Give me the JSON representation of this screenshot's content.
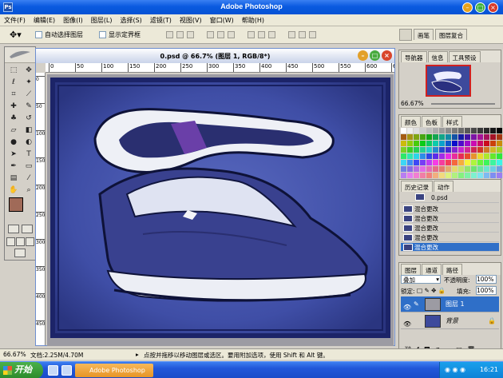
{
  "app": {
    "title": "Adobe Photoshop",
    "icon": "Ps"
  },
  "menu": [
    {
      "label": "文件(F)"
    },
    {
      "label": "编辑(E)"
    },
    {
      "label": "图像(I)"
    },
    {
      "label": "图层(L)"
    },
    {
      "label": "选择(S)"
    },
    {
      "label": "滤镜(T)"
    },
    {
      "label": "视图(V)"
    },
    {
      "label": "窗口(W)"
    },
    {
      "label": "帮助(H)"
    }
  ],
  "options": {
    "auto_select": "自动选择图层",
    "show_bounds": "显示定界框"
  },
  "palette_well": {
    "tabs": [
      {
        "label": "画笔"
      },
      {
        "label": "图层复合"
      }
    ]
  },
  "document": {
    "title": "0.psd @ 66.7% (图层 1, RGB/8*)",
    "ruler_marks": [
      "0",
      "50",
      "100",
      "150",
      "200",
      "250",
      "300",
      "350",
      "400",
      "450",
      "500",
      "550",
      "600",
      "650"
    ],
    "vruler_marks": [
      "0",
      "50",
      "100",
      "150",
      "200",
      "250",
      "300",
      "350",
      "400",
      "450"
    ]
  },
  "status": {
    "zoom": "66.67%",
    "doc_size": "文档:2.25M/4.70M",
    "hint": "点按并拖移以移动图层或选区。要用附加选项，使用 Shift 和 Alt 键。"
  },
  "navigator": {
    "tabs": [
      {
        "label": "导航器"
      },
      {
        "label": "信息"
      },
      {
        "label": "工具预设"
      }
    ],
    "zoom": "66.67%"
  },
  "swatches": {
    "tabs": [
      {
        "label": "颜色"
      },
      {
        "label": "色板"
      },
      {
        "label": "样式"
      }
    ]
  },
  "history": {
    "tabs": [
      {
        "label": "历史记录"
      },
      {
        "label": "动作"
      }
    ],
    "snapshot": "0.psd",
    "items": [
      {
        "label": "混合更改"
      },
      {
        "label": "混合更改"
      },
      {
        "label": "混合更改"
      },
      {
        "label": "混合更改"
      },
      {
        "label": "混合更改"
      }
    ]
  },
  "layers": {
    "tabs": [
      {
        "label": "图层"
      },
      {
        "label": "通道"
      },
      {
        "label": "路径"
      }
    ],
    "blend_mode": "叠加",
    "opacity_label": "不透明度:",
    "opacity": "100%",
    "lock_label": "锁定:",
    "fill_label": "填充:",
    "fill": "100%",
    "rows": [
      {
        "name": "图层 1"
      },
      {
        "name": "背景"
      }
    ]
  },
  "taskbar": {
    "start": "开始",
    "task": "Adobe Photoshop",
    "clock": "16:21"
  },
  "colors": {
    "foreground": "#a06a58",
    "accent": "#0a5ae0",
    "selection": "#2f6fc8"
  }
}
